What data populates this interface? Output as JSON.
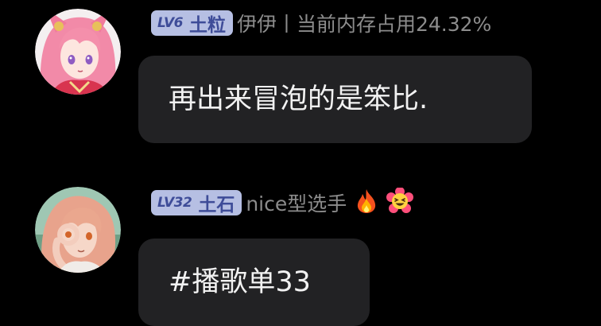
{
  "messages": [
    {
      "badge_level": "LV6",
      "badge_title": "土粒",
      "username": "伊伊丨当前内存占用24.32%",
      "text": "再出来冒泡的是笨比.",
      "avatar": "anime-pink-hair-fox-ears-avatar"
    },
    {
      "badge_level": "LV32",
      "badge_title": "土石",
      "username": "nice型选手",
      "username_emojis": [
        "fire-emoji",
        "grinning-flower-emoji"
      ],
      "text": "#播歌单33",
      "avatar": "anime-orange-hair-avatar"
    }
  ],
  "colors": {
    "background": "#000000",
    "bubble": "#222224",
    "badge_bg": "#b6bfe3",
    "badge_text": "#3e4c98",
    "username": "#8c8c8c",
    "message_text": "#f2f2f2"
  }
}
